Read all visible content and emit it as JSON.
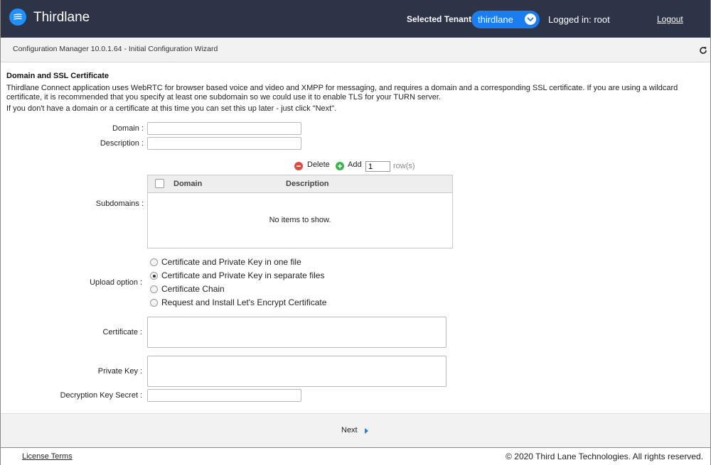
{
  "header": {
    "app_title": "Thirdlane",
    "logo_icon": "menu-lines-icon",
    "tenant_label": "Selected Tenant :",
    "tenant_value": "thirdlane",
    "logged_in": "Logged in: root",
    "logout_label": "Logout",
    "brand_color": "#2d3447",
    "accent_color": "#1a7ef0"
  },
  "subheader": {
    "title": "Configuration Manager 10.0.1.64 - Initial Configuration Wizard",
    "refresh_icon": "refresh-icon"
  },
  "section": {
    "title": "Domain and SSL Certificate",
    "intro": "Thirdlane Connect application uses WebRTC for browser based voice and video and XMPP for messaging, and requires a domain and a corresponding SSL certificate. If you are using a wildcard certificate, it is recommended that you specify at least one subdomain so we could use it to enable TLS for your TURN server.",
    "intro2": "If you don't have a domain or a certificate at this time you can set this up later - just click \"Next\"."
  },
  "form": {
    "domain_label": "Domain :",
    "domain_value": "",
    "description_label": "Description :",
    "description_value": "",
    "subdomains_label": "Subdomains :",
    "delete_label": "Delete",
    "add_label": "Add",
    "rows_value": "1",
    "rows_suffix": "row(s)",
    "grid": {
      "columns": [
        "Domain",
        "Description"
      ],
      "empty_text": "No items to show."
    },
    "upload_label": "Upload option",
    "upload_colon": ":",
    "upload_options": [
      {
        "label": "Certificate and Private Key in one file",
        "checked": false
      },
      {
        "label": "Certificate and Private Key in separate files",
        "checked": true
      },
      {
        "label": "Certificate Chain",
        "checked": false
      },
      {
        "label": "Request and Install Let's Encrypt Certificate",
        "checked": false
      }
    ],
    "certificate_label": "Certificate",
    "private_key_label": "Private Key",
    "decryption_label": "Decryption Key Secret",
    "colon": ":"
  },
  "actions": {
    "next_label": "Next"
  },
  "footer": {
    "license_label": "License Terms",
    "copyright": "© 2020 Third Lane Technologies. All rights reserved."
  }
}
